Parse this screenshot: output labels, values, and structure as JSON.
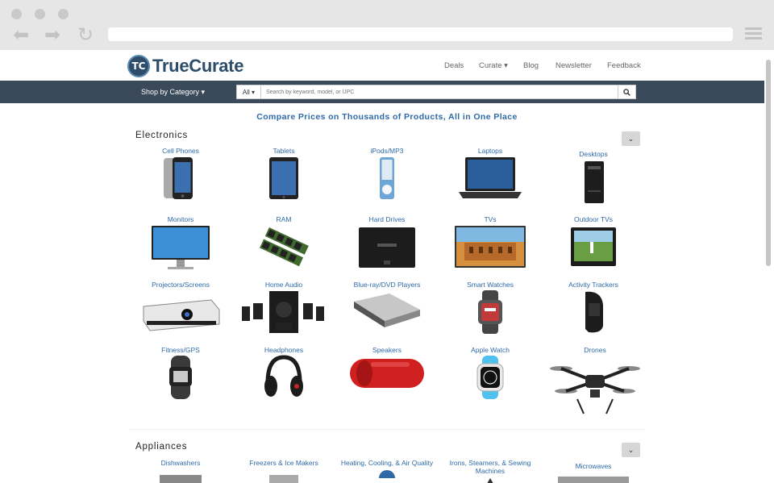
{
  "header": {
    "logo_badge": "TC",
    "logo_text": "TrueCurate",
    "nav": [
      "Deals",
      "Curate ▾",
      "Blog",
      "Newsletter",
      "Feedback"
    ]
  },
  "catbar": {
    "shop_label": "Shop by Category ▾",
    "search_scope": "All ▾",
    "search_placeholder": "Search by keyword, model, or UPC"
  },
  "tagline": "Compare Prices on Thousands of Products, All in One Place",
  "sections": [
    {
      "title": "Electronics",
      "items": [
        "Cell Phones",
        "Tablets",
        "iPods/MP3",
        "Laptops",
        "Desktops",
        "Monitors",
        "RAM",
        "Hard Drives",
        "TVs",
        "Outdoor TVs",
        "Projectors/Screens",
        "Home Audio",
        "Blue-ray/DVD Players",
        "Smart Watches",
        "Activity Trackers",
        "Fitness/GPS",
        "Headphones",
        "Speakers",
        "Apple Watch",
        "Drones"
      ]
    },
    {
      "title": "Appliances",
      "items": [
        "Dishwashers",
        "Freezers & Ice Makers",
        "Heating, Cooling, & Air Quality",
        "Irons, Steamers, & Sewing Machines",
        "Microwaves"
      ]
    }
  ],
  "colors": {
    "accent": "#2e6aa8",
    "catbar": "#3a4a5a"
  }
}
